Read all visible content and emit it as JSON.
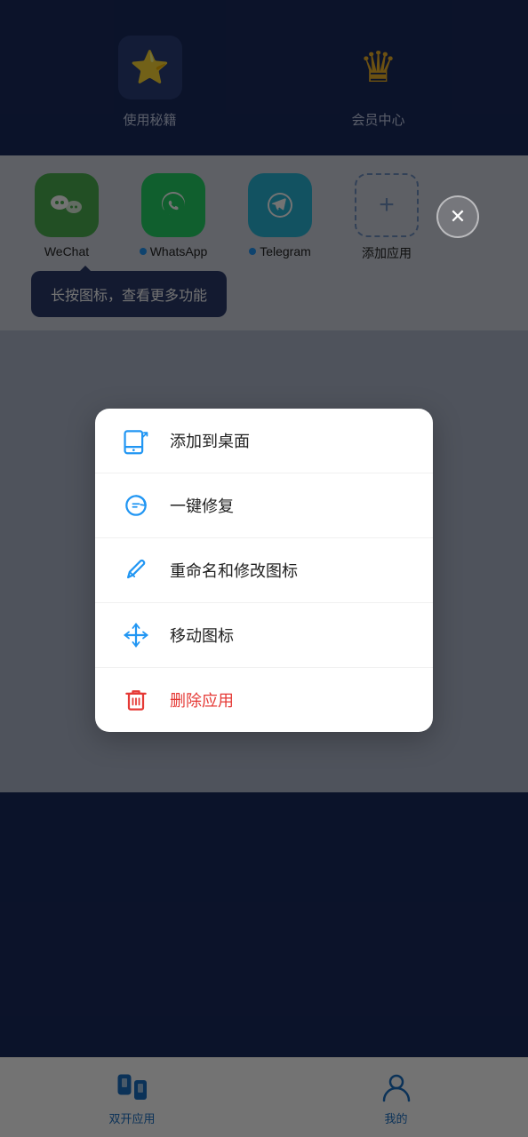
{
  "header": {
    "secrets_label": "使用秘籍",
    "member_label": "会员中心",
    "secrets_icon": "⭐",
    "member_icon": "👑"
  },
  "apps": [
    {
      "id": "wechat",
      "label": "WeChat",
      "has_dot": false,
      "bg": "wechat-bg",
      "emoji": "💬"
    },
    {
      "id": "whatsapp",
      "label": "WhatsApp",
      "has_dot": true,
      "bg": "whatsapp-bg",
      "emoji": "📱"
    },
    {
      "id": "telegram",
      "label": "Telegram",
      "has_dot": true,
      "bg": "telegram-bg",
      "emoji": "✈️"
    }
  ],
  "add_app_label": "添加应用",
  "tooltip": "长按图标，查看更多功能",
  "close_icon": "✕",
  "context_menu": {
    "items": [
      {
        "id": "add-to-desktop",
        "label": "添加到桌面",
        "icon_type": "tablet"
      },
      {
        "id": "one-click-repair",
        "label": "一键修复",
        "icon_type": "repair"
      },
      {
        "id": "rename-icon",
        "label": "重命名和修改图标",
        "icon_type": "pencil"
      },
      {
        "id": "move-icon",
        "label": "移动图标",
        "icon_type": "move"
      },
      {
        "id": "delete-app",
        "label": "删除应用",
        "icon_type": "trash",
        "is_danger": true
      }
    ]
  },
  "bottom_nav": {
    "items": [
      {
        "id": "dual-app",
        "label": "双开应用",
        "icon_type": "dual"
      },
      {
        "id": "mine",
        "label": "我的",
        "icon_type": "person"
      }
    ]
  }
}
